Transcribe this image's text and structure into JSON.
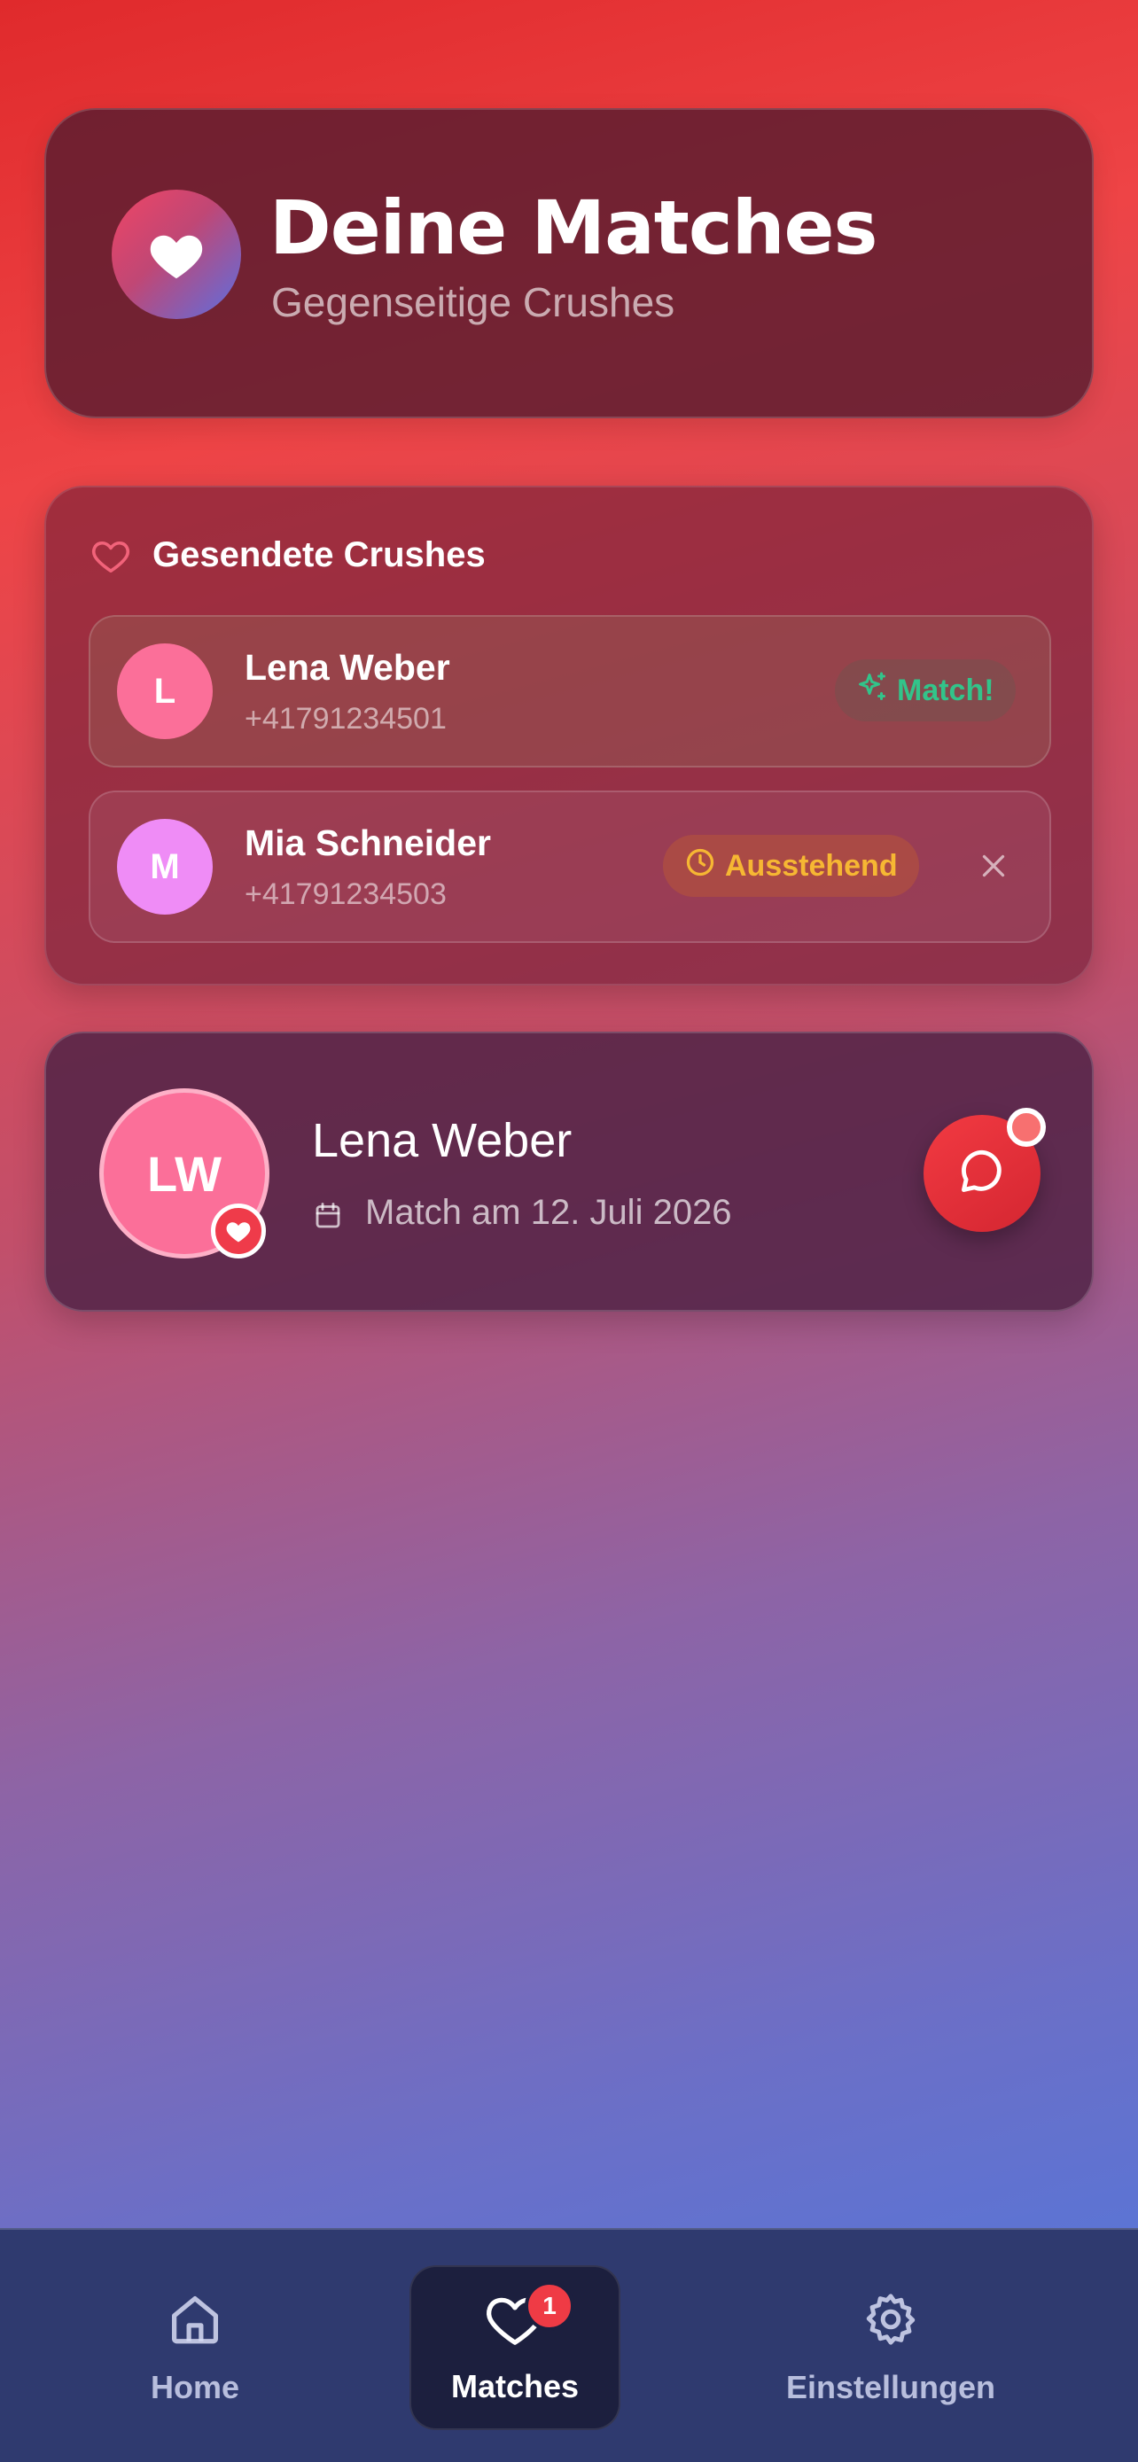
{
  "header": {
    "title": "Deine Matches",
    "subtitle": "Gegenseitige Crushes",
    "logo_icon": "heart-icon"
  },
  "sent_crushes": {
    "heading": "Gesendete Crushes",
    "heading_icon": "heart-outline-icon",
    "items": [
      {
        "initial": "L",
        "avatar_color": "#fb6f99",
        "name": "Lena Weber",
        "phone": "+41791234501",
        "status": "Match!",
        "status_icon": "sparkles-icon",
        "status_color": "#32c48a"
      },
      {
        "initial": "M",
        "avatar_color": "#ef8cf6",
        "name": "Mia Schneider",
        "phone": "+41791234503",
        "status": "Ausstehend",
        "status_icon": "clock-icon",
        "status_color": "#f6b733",
        "removable": true
      }
    ]
  },
  "match": {
    "initials": "LW",
    "avatar_color": "#fb6f99",
    "name": "Lena Weber",
    "date_label": "Match am 12. Juli 2026",
    "date_icon": "calendar-icon",
    "chat_icon": "chat-bubble-icon",
    "unread_indicator": true
  },
  "nav": {
    "items": [
      {
        "label": "Home",
        "icon": "home-icon",
        "active": false
      },
      {
        "label": "Matches",
        "icon": "heart-outline-icon",
        "active": true,
        "badge": "1"
      },
      {
        "label": "Einstellungen",
        "icon": "gear-icon",
        "active": false
      }
    ]
  },
  "colors": {
    "accent_red": "#ef3b45",
    "match_green": "#32c48a",
    "pending_amber": "#f6b733",
    "nav_bg": "#2f3a6f"
  }
}
